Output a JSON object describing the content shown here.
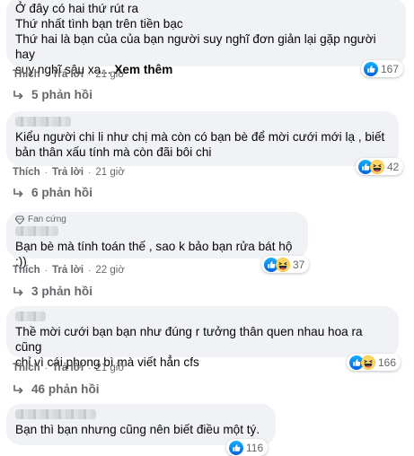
{
  "comments": [
    {
      "lines": [
        "Ở đây có hai thứ rút ra",
        "Thứ nhất tình bạn trên tiền bạc",
        "Thứ hai là bạn của của bạn người suy nghĩ đơn giản lại gặp người hay",
        "suy nghĩ sâu xa..."
      ],
      "see_more": "Xem thêm",
      "like": "Thích",
      "reply": "Trả lời",
      "time": "21 giờ",
      "reactions": [
        "like"
      ],
      "reaction_count": "167",
      "replies": "5 phản hồi"
    },
    {
      "lines": [
        "Kiểu người chi li như chị mà còn có bạn bè để mời cưới mới lạ , biết",
        "bản thân xấu tính mà còn đãi bôi chi"
      ],
      "like": "Thích",
      "reply": "Trả lời",
      "time": "21 giờ",
      "reactions": [
        "like",
        "haha"
      ],
      "reaction_count": "42",
      "replies": "6 phản hồi"
    },
    {
      "badge": "Fan cứng",
      "lines": [
        "Bạn bè mà tính toán thế , sao k bảo bạn rửa bát hộ :))"
      ],
      "like": "Thích",
      "reply": "Trả lời",
      "time": "22 giờ",
      "reactions": [
        "like",
        "haha"
      ],
      "reaction_count": "37",
      "replies": "3 phản hồi"
    },
    {
      "lines": [
        "Thề mời cưới bạn bạn như đúng r tưởng thân quen nhau hoa ra cũng",
        "chỉ vì cái phong bì mà viết hẳn cfs"
      ],
      "like": "Thích",
      "reply": "Trả lời",
      "time": "21 giờ",
      "reactions": [
        "like",
        "haha"
      ],
      "reaction_count": "166",
      "replies": "46 phản hồi"
    },
    {
      "lines": [
        "Bạn thì bạn nhưng cũng nên biết điều một tý."
      ],
      "reactions": [
        "like"
      ],
      "reaction_count": "116"
    }
  ]
}
